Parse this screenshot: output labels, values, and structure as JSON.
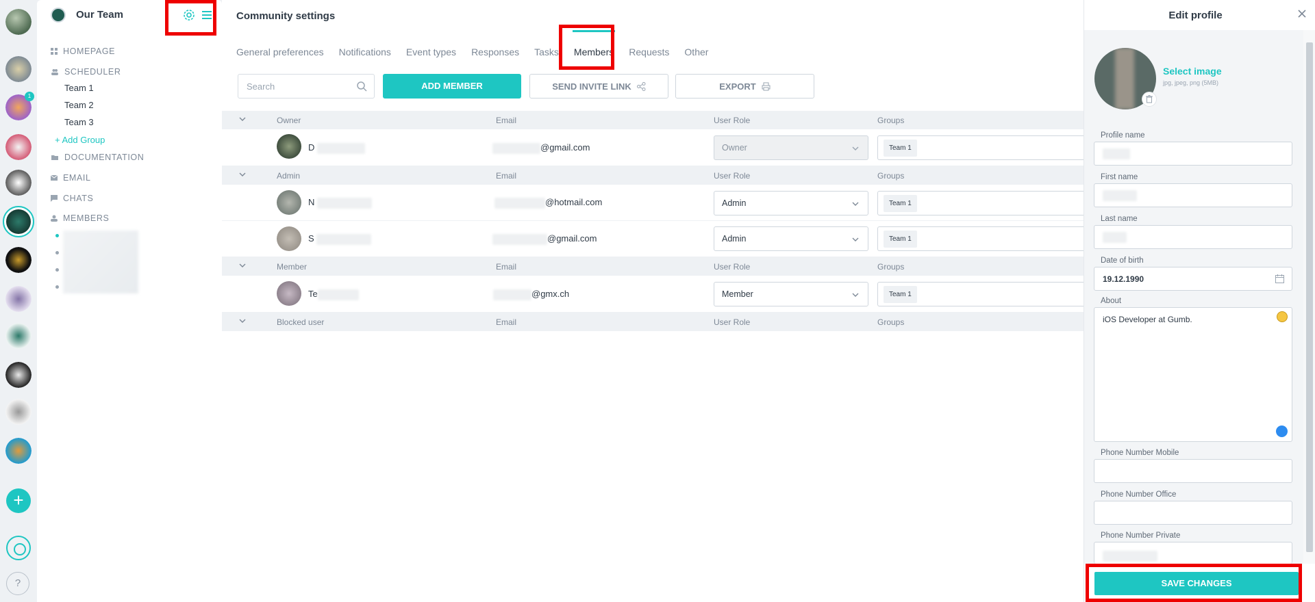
{
  "sidebar": {
    "title": "Our Team",
    "items": [
      {
        "label": "HOMEPAGE"
      },
      {
        "label": "SCHEDULER"
      },
      {
        "label": "DOCUMENTATION"
      },
      {
        "label": "EMAIL"
      },
      {
        "label": "CHATS"
      },
      {
        "label": "MEMBERS"
      }
    ],
    "teams": [
      "Team 1",
      "Team 2",
      "Team 3"
    ],
    "add_group": "+ Add Group"
  },
  "rail": {
    "badge": "1",
    "add": "+",
    "help": "?"
  },
  "main": {
    "title": "Community settings",
    "tabs": [
      "General preferences",
      "Notifications",
      "Event types",
      "Responses",
      "Tasks",
      "Members",
      "Requests",
      "Other"
    ],
    "search_placeholder": "Search",
    "add_member": "ADD MEMBER",
    "send_invite": "SEND INVITE LINK",
    "export": "EXPORT",
    "col_email": "Email",
    "col_role": "User Role",
    "col_groups": "Groups",
    "groups": [
      {
        "name": "Owner",
        "members": [
          {
            "name_prefix": "D",
            "email_suffix": "@gmail.com",
            "role": "Owner",
            "group": "Team 1"
          }
        ]
      },
      {
        "name": "Admin",
        "members": [
          {
            "name_prefix": "N",
            "email_suffix": "@hotmail.com",
            "role": "Admin",
            "group": "Team 1"
          },
          {
            "name_prefix": "S",
            "email_suffix": "@gmail.com",
            "role": "Admin",
            "group": "Team 1"
          }
        ]
      },
      {
        "name": "Member",
        "members": [
          {
            "name_prefix": "Te",
            "email_suffix": "@gmx.ch",
            "role": "Member",
            "group": "Team 1"
          }
        ]
      },
      {
        "name": "Blocked user",
        "members": []
      }
    ]
  },
  "panel": {
    "title": "Edit profile",
    "select_image": "Select image",
    "image_hint": "jpg, jpeg, png (5MB)",
    "profile_name_label": "Profile name",
    "first_name_label": "First name",
    "last_name_label": "Last name",
    "dob_label": "Date of birth",
    "dob_value": "19.12.1990",
    "about_label": "About",
    "about_value": "iOS Developer at Gumb.",
    "phone_mobile_label": "Phone Number Mobile",
    "phone_office_label": "Phone Number Office",
    "phone_private_label": "Phone Number Private",
    "save": "SAVE CHANGES"
  },
  "colors": {
    "accent": "#1ec6c2",
    "highlight": "#ee0000"
  }
}
